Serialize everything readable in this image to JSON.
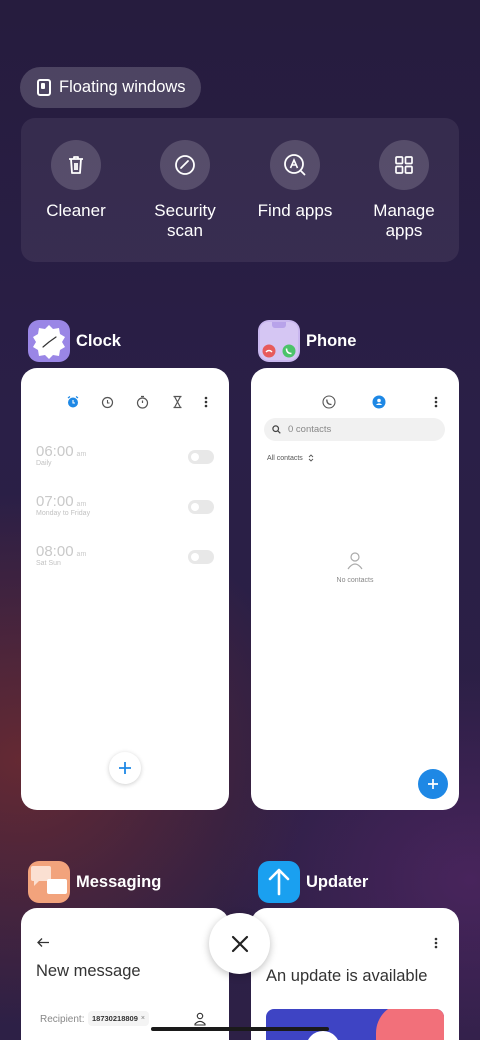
{
  "floating_windows": {
    "label": "Floating windows",
    "icon": "floating-window-icon"
  },
  "tools": [
    {
      "label": "Cleaner",
      "icon": "trash-icon"
    },
    {
      "label": "Security\nscan",
      "icon": "security-scan-icon"
    },
    {
      "label": "Find apps",
      "icon": "find-apps-icon"
    },
    {
      "label": "Manage\napps",
      "icon": "grid-icon"
    }
  ],
  "clock": {
    "name": "Clock",
    "alarms": [
      {
        "time": "06:00",
        "ampm": "am",
        "repeat": "Daily"
      },
      {
        "time": "07:00",
        "ampm": "am",
        "repeat": "Monday to Friday"
      },
      {
        "time": "08:00",
        "ampm": "am",
        "repeat": "Sat Sun"
      }
    ],
    "accent": "#1e88e5"
  },
  "phone": {
    "name": "Phone",
    "search_placeholder": "0 contacts",
    "filter": "All contacts",
    "empty_text": "No contacts",
    "accent": "#1e88e5"
  },
  "messaging": {
    "name": "Messaging",
    "title": "New message",
    "recipient_label": "Recipient:",
    "recipient_chip": "18730218809"
  },
  "updater": {
    "name": "Updater",
    "title": "An update is available"
  }
}
